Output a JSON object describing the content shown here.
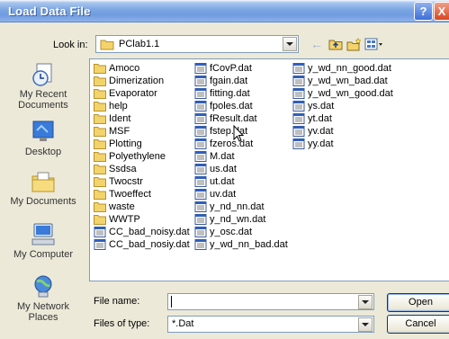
{
  "window": {
    "title": "Load Data File",
    "help_label": "?",
    "close_label": "X"
  },
  "toolbar": {
    "look_in_label": "Look in:",
    "look_in_value": "PClab1.1"
  },
  "places": [
    {
      "label": "My Recent Documents",
      "icon": "recent-documents-icon"
    },
    {
      "label": "Desktop",
      "icon": "desktop-icon"
    },
    {
      "label": "My Documents",
      "icon": "my-documents-icon"
    },
    {
      "label": "My Computer",
      "icon": "my-computer-icon"
    },
    {
      "label": "My Network Places",
      "icon": "network-places-icon"
    }
  ],
  "files": {
    "col1": [
      {
        "name": "Amoco",
        "type": "folder"
      },
      {
        "name": "Dimerization",
        "type": "folder"
      },
      {
        "name": "Evaporator",
        "type": "folder"
      },
      {
        "name": "help",
        "type": "folder"
      },
      {
        "name": "Ident",
        "type": "folder"
      },
      {
        "name": "MSF",
        "type": "folder"
      },
      {
        "name": "Plotting",
        "type": "folder"
      },
      {
        "name": "Polyethylene",
        "type": "folder"
      },
      {
        "name": "Ssdsa",
        "type": "folder"
      },
      {
        "name": "Twocstr",
        "type": "folder"
      },
      {
        "name": "Twoeffect",
        "type": "folder"
      },
      {
        "name": "waste",
        "type": "folder"
      },
      {
        "name": "WWTP",
        "type": "folder"
      },
      {
        "name": "CC_bad_noisy.dat",
        "type": "file"
      },
      {
        "name": "CC_bad_nosiy.dat",
        "type": "file"
      }
    ],
    "col2": [
      {
        "name": "fCovP.dat",
        "type": "file"
      },
      {
        "name": "fgain.dat",
        "type": "file"
      },
      {
        "name": "fitting.dat",
        "type": "file"
      },
      {
        "name": "fpoles.dat",
        "type": "file"
      },
      {
        "name": "fResult.dat",
        "type": "file"
      },
      {
        "name": "fstep.dat",
        "type": "file"
      },
      {
        "name": "fzeros.dat",
        "type": "file"
      },
      {
        "name": "M.dat",
        "type": "file"
      },
      {
        "name": "us.dat",
        "type": "file"
      },
      {
        "name": "ut.dat",
        "type": "file"
      },
      {
        "name": "uv.dat",
        "type": "file"
      },
      {
        "name": "y_nd_nn.dat",
        "type": "file"
      },
      {
        "name": "y_nd_wn.dat",
        "type": "file"
      },
      {
        "name": "y_osc.dat",
        "type": "file"
      },
      {
        "name": "y_wd_nn_bad.dat",
        "type": "file"
      }
    ],
    "col3": [
      {
        "name": "y_wd_nn_good.dat",
        "type": "file"
      },
      {
        "name": "y_wd_wn_bad.dat",
        "type": "file"
      },
      {
        "name": "y_wd_wn_good.dat",
        "type": "file"
      },
      {
        "name": "ys.dat",
        "type": "file"
      },
      {
        "name": "yt.dat",
        "type": "file"
      },
      {
        "name": "yv.dat",
        "type": "file"
      },
      {
        "name": "yy.dat",
        "type": "file"
      }
    ]
  },
  "form": {
    "file_name_label": "File name:",
    "file_name_value": "",
    "files_of_type_label": "Files of type:",
    "files_of_type_value": "*.Dat",
    "open_label": "Open",
    "cancel_label": "Cancel"
  },
  "colors": {
    "titlebar": "#7ba6e3",
    "folder": "#f3d36b",
    "dialog_bg": "#ece9d8"
  }
}
